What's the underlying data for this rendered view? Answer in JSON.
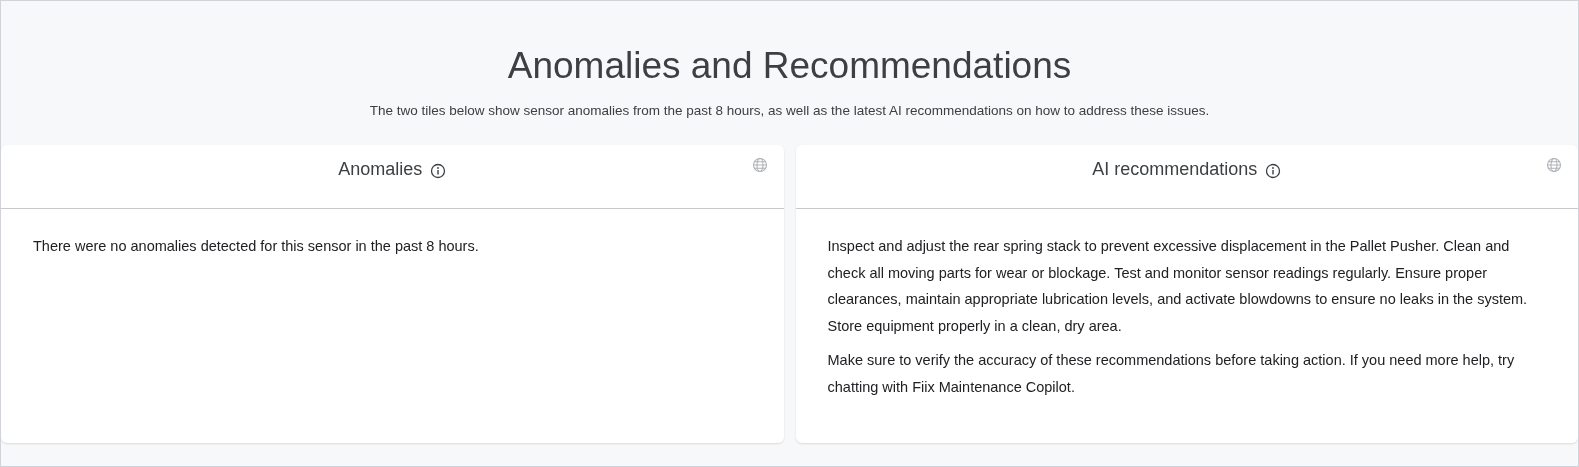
{
  "header": {
    "title": "Anomalies and Recommendations",
    "subtitle": "The two tiles below show sensor anomalies from the past 8 hours, as well as the latest AI recommendations on how to address these issues."
  },
  "tiles": [
    {
      "title": "Anomalies",
      "paragraphs": [
        "There were no anomalies detected for this sensor in the past 8 hours."
      ]
    },
    {
      "title": "AI recommendations",
      "paragraphs": [
        "Inspect and adjust the rear spring stack to prevent excessive displacement in the Pallet Pusher. Clean and check all moving parts for wear or blockage. Test and monitor sensor readings regularly. Ensure proper clearances, maintain appropriate lubrication levels, and activate blowdowns to ensure no leaks in the system. Store equipment properly in a clean, dry area.",
        "Make sure to verify the accuracy of these recommendations before taking action. If you need more help, try chatting with Fiix Maintenance Copilot."
      ]
    }
  ]
}
